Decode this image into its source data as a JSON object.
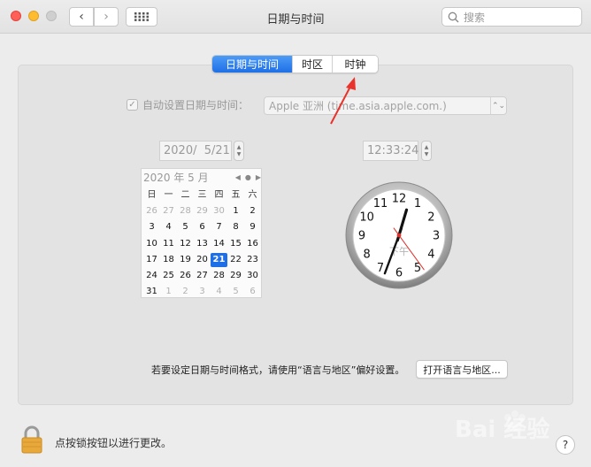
{
  "window": {
    "title": "日期与时间"
  },
  "toolbar": {
    "back_icon": "chevron-left",
    "forward_icon": "chevron-right",
    "grid_icon": "grid"
  },
  "search": {
    "placeholder": "搜索"
  },
  "tabs": [
    {
      "label": "日期与时间",
      "active": true
    },
    {
      "label": "时区",
      "active": false
    },
    {
      "label": "时钟",
      "active": false
    }
  ],
  "auto_set": {
    "label": "自动设置日期与时间：",
    "checked": true,
    "server": "Apple 亚洲 (time.asia.apple.com.)"
  },
  "date_field": {
    "value": "2020/  5/21"
  },
  "time_field": {
    "value": "12:33:24"
  },
  "calendar": {
    "month_label": "2020 年 5 月",
    "weekdays": [
      "日",
      "一",
      "二",
      "三",
      "四",
      "五",
      "六"
    ],
    "weeks": [
      [
        {
          "d": "26",
          "dim": true
        },
        {
          "d": "27",
          "dim": true
        },
        {
          "d": "28",
          "dim": true
        },
        {
          "d": "29",
          "dim": true
        },
        {
          "d": "30",
          "dim": true
        },
        {
          "d": "1"
        },
        {
          "d": "2"
        }
      ],
      [
        {
          "d": "3"
        },
        {
          "d": "4"
        },
        {
          "d": "5"
        },
        {
          "d": "6"
        },
        {
          "d": "7"
        },
        {
          "d": "8"
        },
        {
          "d": "9"
        }
      ],
      [
        {
          "d": "10"
        },
        {
          "d": "11"
        },
        {
          "d": "12"
        },
        {
          "d": "13"
        },
        {
          "d": "14"
        },
        {
          "d": "15"
        },
        {
          "d": "16"
        }
      ],
      [
        {
          "d": "17"
        },
        {
          "d": "18"
        },
        {
          "d": "19"
        },
        {
          "d": "20"
        },
        {
          "d": "21",
          "sel": true
        },
        {
          "d": "22"
        },
        {
          "d": "23"
        }
      ],
      [
        {
          "d": "24"
        },
        {
          "d": "25"
        },
        {
          "d": "26"
        },
        {
          "d": "27"
        },
        {
          "d": "28"
        },
        {
          "d": "29"
        },
        {
          "d": "30"
        }
      ],
      [
        {
          "d": "31"
        },
        {
          "d": "1",
          "dim": true
        },
        {
          "d": "2",
          "dim": true
        },
        {
          "d": "3",
          "dim": true
        },
        {
          "d": "4",
          "dim": true
        },
        {
          "d": "5",
          "dim": true
        },
        {
          "d": "6",
          "dim": true
        }
      ]
    ]
  },
  "clock": {
    "numerals": [
      "12",
      "1",
      "2",
      "3",
      "4",
      "5",
      "6",
      "7",
      "8",
      "9",
      "10",
      "11"
    ],
    "period_label": "下午",
    "time": {
      "hour": 12,
      "minute": 33,
      "second": 24
    }
  },
  "footer": {
    "hint": "若要设定日期与时间格式，请使用“语言与地区”偏好设置。",
    "region_button": "打开语言与地区...",
    "lock_text": "点按锁按钮以进行更改。",
    "help_label": "?"
  },
  "watermark": {
    "text": "Bai 经验"
  },
  "colors": {
    "accent": "#1f6fe6",
    "annotation_arrow": "#e8322b",
    "second_hand": "#e0302a"
  }
}
